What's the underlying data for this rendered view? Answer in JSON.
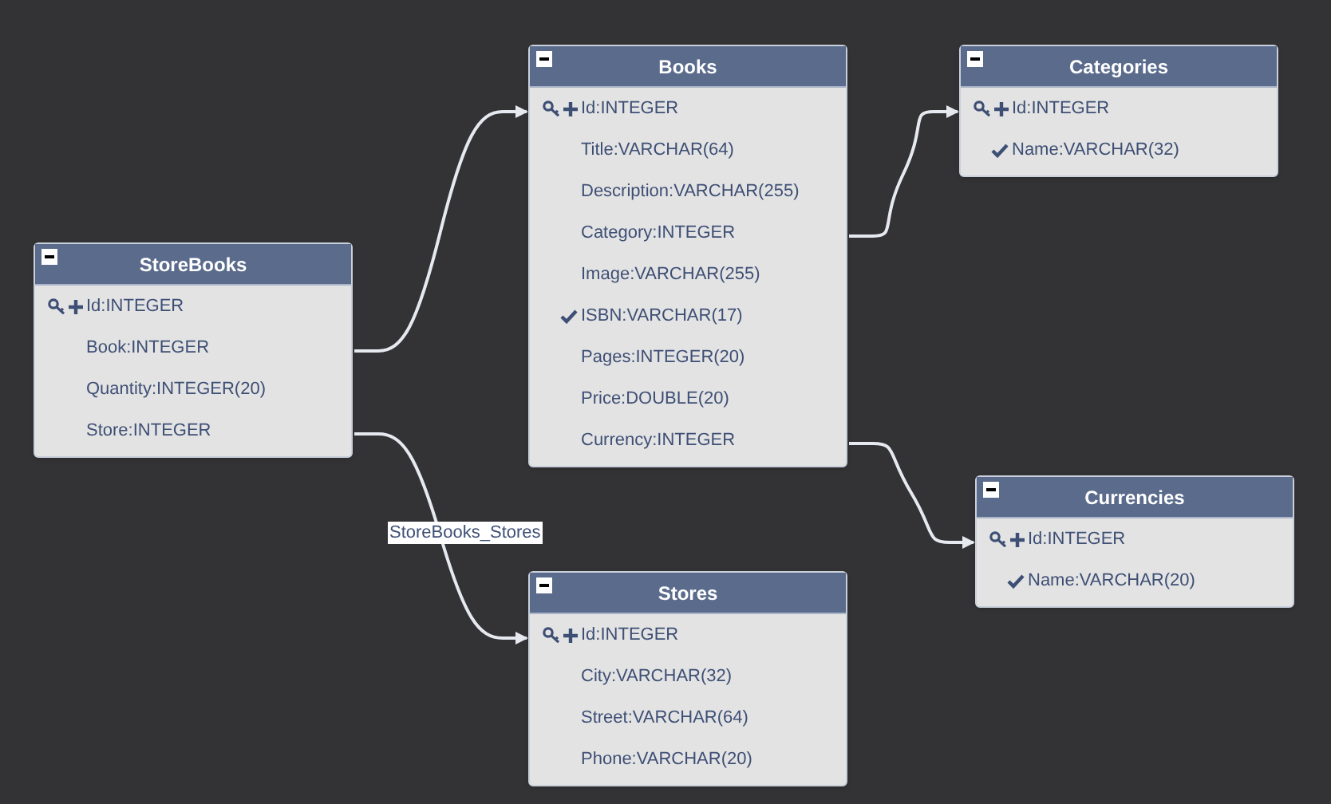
{
  "tables": [
    {
      "name": "StoreBooks",
      "fields": [
        {
          "kind": "pk",
          "text": "Id:INTEGER"
        },
        {
          "kind": "plain",
          "text": "Book:INTEGER"
        },
        {
          "kind": "plain",
          "text": "Quantity:INTEGER(20)"
        },
        {
          "kind": "plain",
          "text": "Store:INTEGER"
        }
      ]
    },
    {
      "name": "Books",
      "fields": [
        {
          "kind": "pk",
          "text": "Id:INTEGER"
        },
        {
          "kind": "plain",
          "text": "Title:VARCHAR(64)"
        },
        {
          "kind": "plain",
          "text": "Description:VARCHAR(255)"
        },
        {
          "kind": "plain",
          "text": "Category:INTEGER"
        },
        {
          "kind": "plain",
          "text": "Image:VARCHAR(255)"
        },
        {
          "kind": "unique",
          "text": "ISBN:VARCHAR(17)"
        },
        {
          "kind": "plain",
          "text": "Pages:INTEGER(20)"
        },
        {
          "kind": "plain",
          "text": "Price:DOUBLE(20)"
        },
        {
          "kind": "plain",
          "text": "Currency:INTEGER"
        }
      ]
    },
    {
      "name": "Categories",
      "fields": [
        {
          "kind": "pk",
          "text": "Id:INTEGER"
        },
        {
          "kind": "unique",
          "text": "Name:VARCHAR(32)"
        }
      ]
    },
    {
      "name": "Currencies",
      "fields": [
        {
          "kind": "pk",
          "text": "Id:INTEGER"
        },
        {
          "kind": "unique",
          "text": "Name:VARCHAR(20)"
        }
      ]
    },
    {
      "name": "Stores",
      "fields": [
        {
          "kind": "pk",
          "text": "Id:INTEGER"
        },
        {
          "kind": "plain",
          "text": "City:VARCHAR(32)"
        },
        {
          "kind": "plain",
          "text": "Street:VARCHAR(64)"
        },
        {
          "kind": "plain",
          "text": "Phone:VARCHAR(20)"
        }
      ]
    }
  ],
  "connector_label": "StoreBooks_Stores"
}
